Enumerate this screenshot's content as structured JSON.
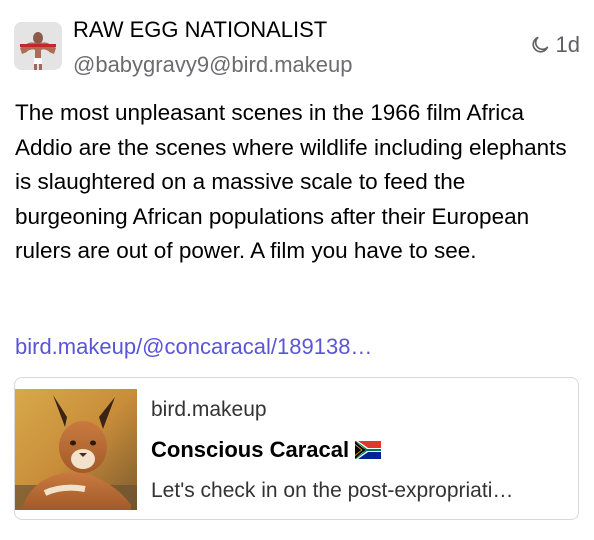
{
  "post": {
    "author": {
      "display_name": "RAW EGG NATIONALIST",
      "handle": "@babygravy9@bird.makeup",
      "avatar_icon": "bodybuilder-avatar"
    },
    "timestamp": "1d",
    "timestamp_icon": "moon-icon",
    "content": "The most unpleasant scenes in the 1966 film Africa Addio are the scenes where wildlife including elephants is slaughtered on a massive scale to feed the burgeoning African populations after their European rulers are out of power. A film you have to see.",
    "link_text": "bird.makeup/@concaracal/189138…"
  },
  "link_card": {
    "domain": "bird.makeup",
    "title": "Conscious Caracal",
    "title_flag": "south-africa-flag",
    "description": "Let's check in on the post-expropriati…",
    "image": "caracal-photo"
  },
  "colors": {
    "link": "#5a55d6",
    "muted_text": "#6c6c71",
    "card_border": "#d8d8dc"
  }
}
